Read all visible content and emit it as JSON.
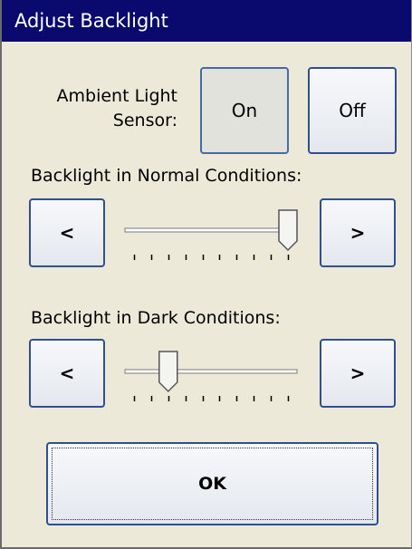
{
  "window": {
    "title": "Adjust Backlight"
  },
  "ambient": {
    "label": "Ambient Light\nSensor:",
    "on_label": "On",
    "off_label": "Off",
    "selected": "On"
  },
  "normal": {
    "label": "Backlight in Normal Conditions:",
    "left_label": "<",
    "right_label": ">",
    "level": 9,
    "max": 9
  },
  "dark": {
    "label": "Backlight in Dark Conditions:",
    "left_label": "<",
    "right_label": ">",
    "level": 2,
    "max": 9
  },
  "ok_label": "OK",
  "colors": {
    "titlebar": "#0a0a6e",
    "background": "#ece9d8",
    "button_border": "#2f4f8f"
  }
}
